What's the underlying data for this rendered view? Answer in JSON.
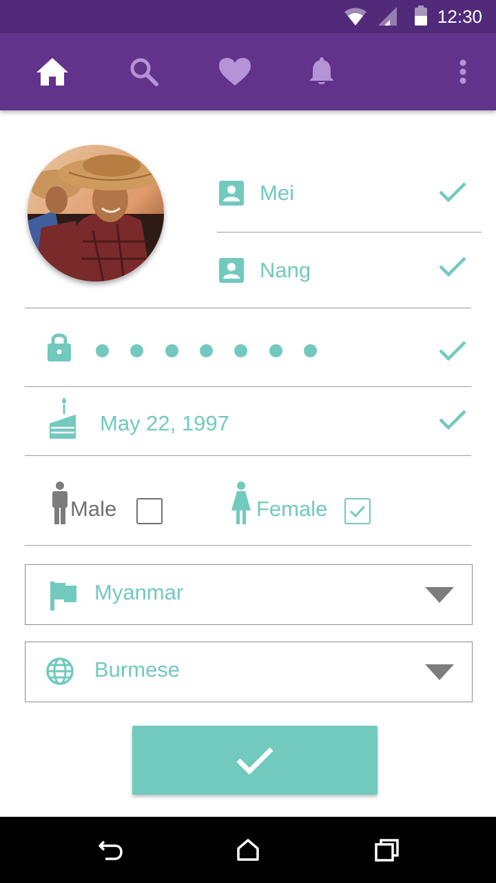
{
  "status_bar": {
    "time": "12:30",
    "icons": [
      "wifi-icon",
      "signal-icon",
      "battery-icon"
    ]
  },
  "app_bar": {
    "icons": [
      "home-icon",
      "search-icon",
      "heart-icon",
      "bell-icon",
      "more-vert-icon"
    ]
  },
  "profile": {
    "first_name": "Mei",
    "last_name": "Nang",
    "password_length": 7,
    "birthday": "May 22, 1997"
  },
  "gender": {
    "male_label": "Male",
    "female_label": "Female",
    "male_checked": false,
    "female_checked": true
  },
  "country_select": {
    "value": "Myanmar",
    "icon": "flag-icon"
  },
  "language_select": {
    "value": "Burmese",
    "icon": "globe-icon"
  },
  "submit": {
    "icon": "check-icon"
  },
  "system_nav": {
    "icons": [
      "back-icon",
      "home-icon",
      "recents-icon"
    ]
  },
  "colors": {
    "primary": "#62338b",
    "primary_dark": "#512a79",
    "accent": "#72c9be"
  }
}
